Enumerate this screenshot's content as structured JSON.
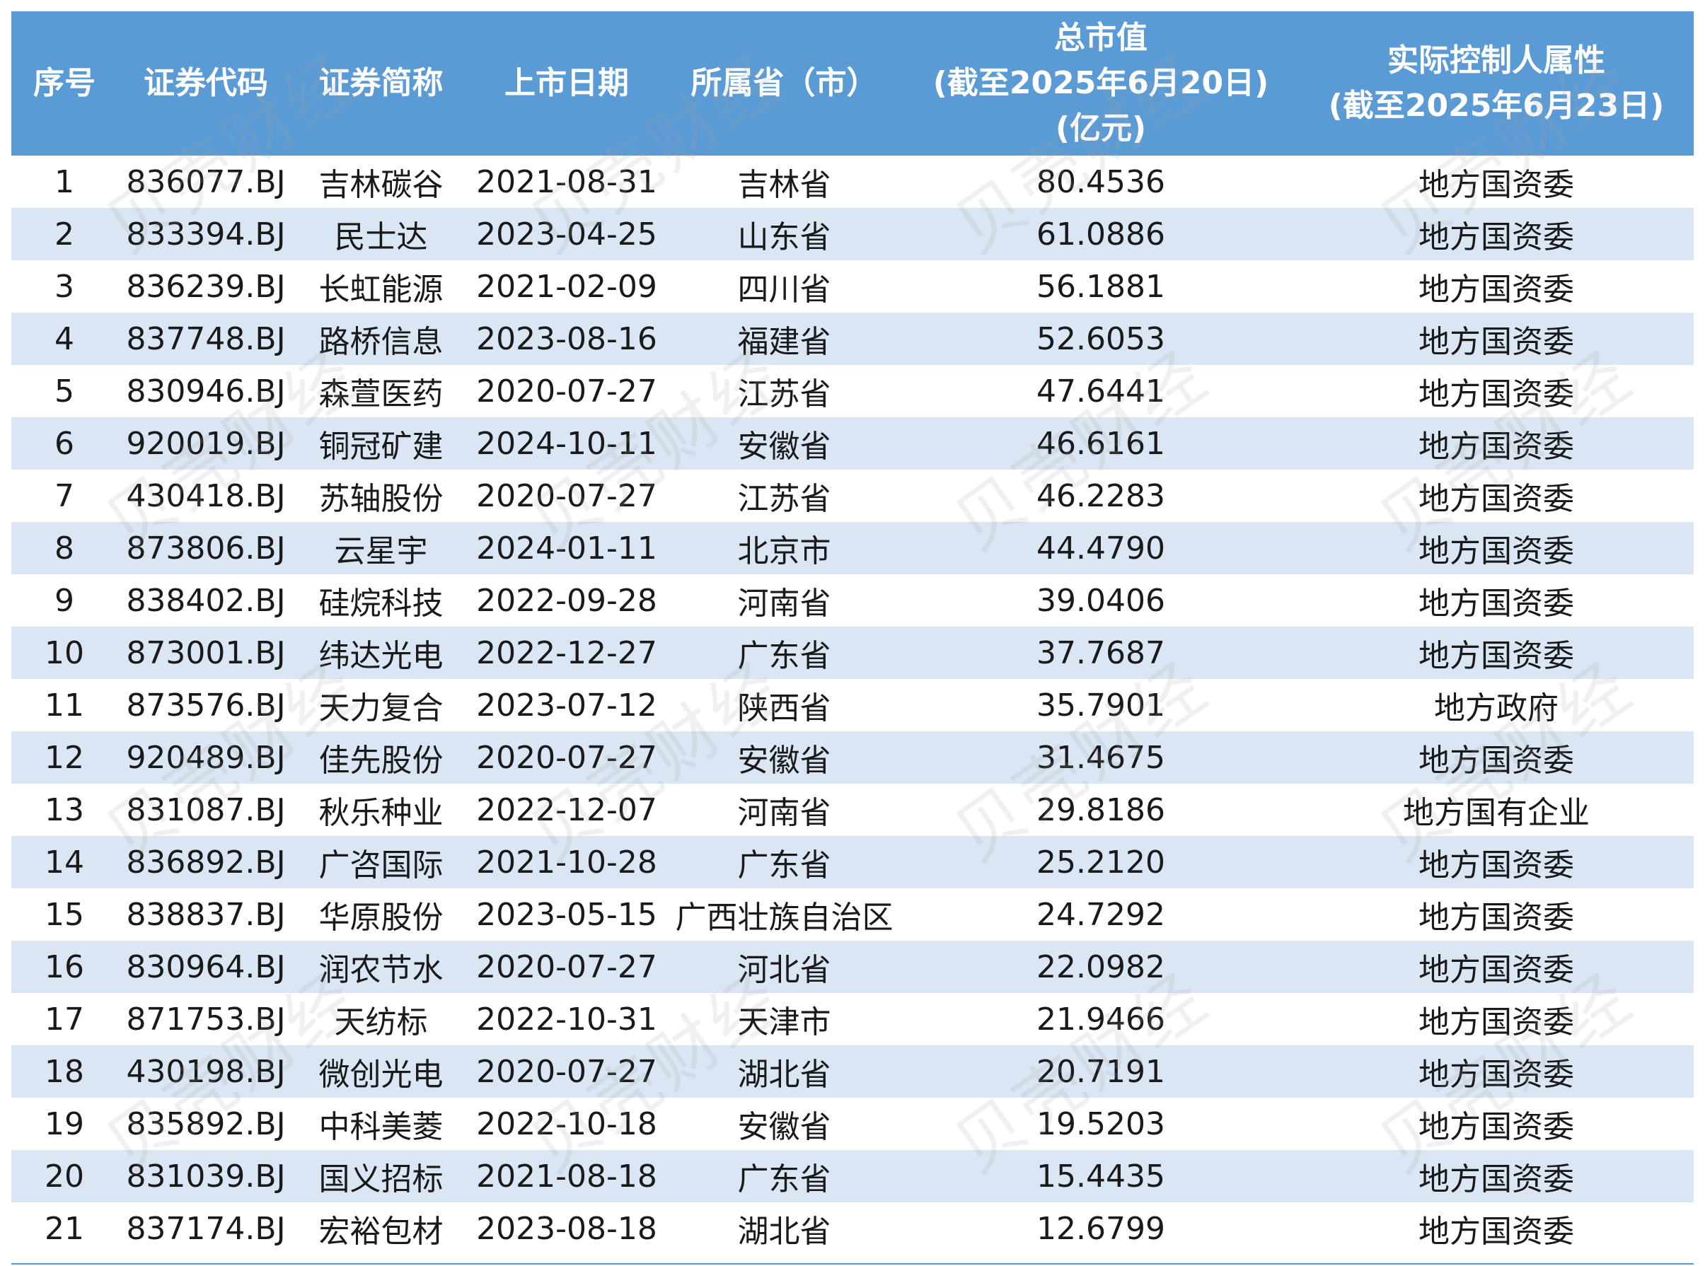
{
  "table": {
    "headers": [
      {
        "lines": [
          "序号"
        ]
      },
      {
        "lines": [
          "证券代码"
        ]
      },
      {
        "lines": [
          "证券简称"
        ]
      },
      {
        "lines": [
          "上市日期"
        ]
      },
      {
        "lines": [
          "所属省（市）"
        ]
      },
      {
        "lines": [
          "总市值",
          "(截至2025年6月20日)",
          "(亿元)"
        ]
      },
      {
        "lines": [
          "实际控制人属性",
          "(截至2025年6月23日)"
        ]
      }
    ],
    "rows": [
      [
        "1",
        "836077.BJ",
        "吉林碳谷",
        "2021-08-31",
        "吉林省",
        "80.4536",
        "地方国资委"
      ],
      [
        "2",
        "833394.BJ",
        "民士达",
        "2023-04-25",
        "山东省",
        "61.0886",
        "地方国资委"
      ],
      [
        "3",
        "836239.BJ",
        "长虹能源",
        "2021-02-09",
        "四川省",
        "56.1881",
        "地方国资委"
      ],
      [
        "4",
        "837748.BJ",
        "路桥信息",
        "2023-08-16",
        "福建省",
        "52.6053",
        "地方国资委"
      ],
      [
        "5",
        "830946.BJ",
        "森萱医药",
        "2020-07-27",
        "江苏省",
        "47.6441",
        "地方国资委"
      ],
      [
        "6",
        "920019.BJ",
        "铜冠矿建",
        "2024-10-11",
        "安徽省",
        "46.6161",
        "地方国资委"
      ],
      [
        "7",
        "430418.BJ",
        "苏轴股份",
        "2020-07-27",
        "江苏省",
        "46.2283",
        "地方国资委"
      ],
      [
        "8",
        "873806.BJ",
        "云星宇",
        "2024-01-11",
        "北京市",
        "44.4790",
        "地方国资委"
      ],
      [
        "9",
        "838402.BJ",
        "硅烷科技",
        "2022-09-28",
        "河南省",
        "39.0406",
        "地方国资委"
      ],
      [
        "10",
        "873001.BJ",
        "纬达光电",
        "2022-12-27",
        "广东省",
        "37.7687",
        "地方国资委"
      ],
      [
        "11",
        "873576.BJ",
        "天力复合",
        "2023-07-12",
        "陕西省",
        "35.7901",
        "地方政府"
      ],
      [
        "12",
        "920489.BJ",
        "佳先股份",
        "2020-07-27",
        "安徽省",
        "31.4675",
        "地方国资委"
      ],
      [
        "13",
        "831087.BJ",
        "秋乐种业",
        "2022-12-07",
        "河南省",
        "29.8186",
        "地方国有企业"
      ],
      [
        "14",
        "836892.BJ",
        "广咨国际",
        "2021-10-28",
        "广东省",
        "25.2120",
        "地方国资委"
      ],
      [
        "15",
        "838837.BJ",
        "华原股份",
        "2023-05-15",
        "广西壮族自治区",
        "24.7292",
        "地方国资委"
      ],
      [
        "16",
        "830964.BJ",
        "润农节水",
        "2020-07-27",
        "河北省",
        "22.0982",
        "地方国资委"
      ],
      [
        "17",
        "871753.BJ",
        "天纺标",
        "2022-10-31",
        "天津市",
        "21.9466",
        "地方国资委"
      ],
      [
        "18",
        "430198.BJ",
        "微创光电",
        "2020-07-27",
        "湖北省",
        "20.7191",
        "地方国资委"
      ],
      [
        "19",
        "835892.BJ",
        "中科美菱",
        "2022-10-18",
        "安徽省",
        "19.5203",
        "地方国资委"
      ],
      [
        "20",
        "831039.BJ",
        "国义招标",
        "2021-08-18",
        "广东省",
        "15.4435",
        "地方国资委"
      ],
      [
        "21",
        "837174.BJ",
        "宏裕包材",
        "2023-08-18",
        "湖北省",
        "12.6799",
        "地方国资委"
      ]
    ]
  },
  "watermark": "贝壳财经"
}
